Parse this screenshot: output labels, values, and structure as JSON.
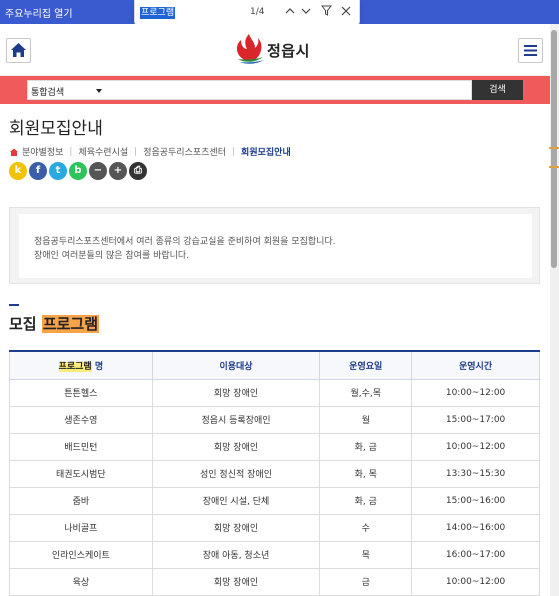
{
  "window": {
    "title": "주요누리집 열기"
  },
  "find_bar": {
    "query": "프로그램",
    "count": "1/4"
  },
  "header": {
    "logo_text": "정읍시"
  },
  "search": {
    "scope": "통합검색",
    "button": "검색"
  },
  "page": {
    "title": "회원모집안내"
  },
  "breadcrumb": [
    "분야별정보",
    "체육수련시설",
    "정읍공두리스포츠센터",
    "회원모집안내"
  ],
  "share": [
    {
      "icon": "kakaostory-icon",
      "glyph": "k",
      "color": "#f2c200"
    },
    {
      "icon": "facebook-icon",
      "glyph": "f",
      "color": "#3b5ea8"
    },
    {
      "icon": "twitter-icon",
      "glyph": "t",
      "color": "#2aa9e0"
    },
    {
      "icon": "band-icon",
      "glyph": "b",
      "color": "#2ec45a"
    },
    {
      "icon": "zoom-out-icon",
      "glyph": "−",
      "color": "#555555"
    },
    {
      "icon": "zoom-in-icon",
      "glyph": "+",
      "color": "#555555"
    },
    {
      "icon": "print-icon",
      "glyph": "⎙",
      "color": "#333333"
    }
  ],
  "intro": {
    "line1": "정읍공두리스포츠센터에서 여러 종류의 강습교실을 준비하여 회원을 모집합니다.",
    "line2": "장애인 여러분들의 많은 참여를 바랍니다."
  },
  "section": {
    "title_prefix": "모집 ",
    "title_highlight": "프로그램"
  },
  "table": {
    "headers": {
      "program_hl": "프로그램",
      "program_rest": " 명",
      "target": "이용대상",
      "days": "운영요일",
      "hours": "운영시간"
    },
    "rows": [
      [
        "튼튼헬스",
        "회망 장애인",
        "월,수,목",
        "10:00~12:00"
      ],
      [
        "생존수영",
        "정읍시 등록장애인",
        "월",
        "15:00~17:00"
      ],
      [
        "배드민턴",
        "회망 장애인",
        "화, 금",
        "10:00~12:00"
      ],
      [
        "태권도시범단",
        "성인 정신적 장애인",
        "화, 목",
        "13:30~15:30"
      ],
      [
        "줌바",
        "장애인 시설, 단체",
        "화, 금",
        "15:00~16:00"
      ],
      [
        "나비골프",
        "회망 장애인",
        "수",
        "14:00~16:00"
      ],
      [
        "인라인스케이트",
        "장애 아동, 청소년",
        "목",
        "16:00~17:00"
      ],
      [
        "육상",
        "회망 장애인",
        "금",
        "10:00~12:00"
      ]
    ]
  },
  "colors": {
    "accent_blue": "#1e3c8c",
    "search_band": "#f05a5a",
    "highlight": "#f6a34a"
  }
}
